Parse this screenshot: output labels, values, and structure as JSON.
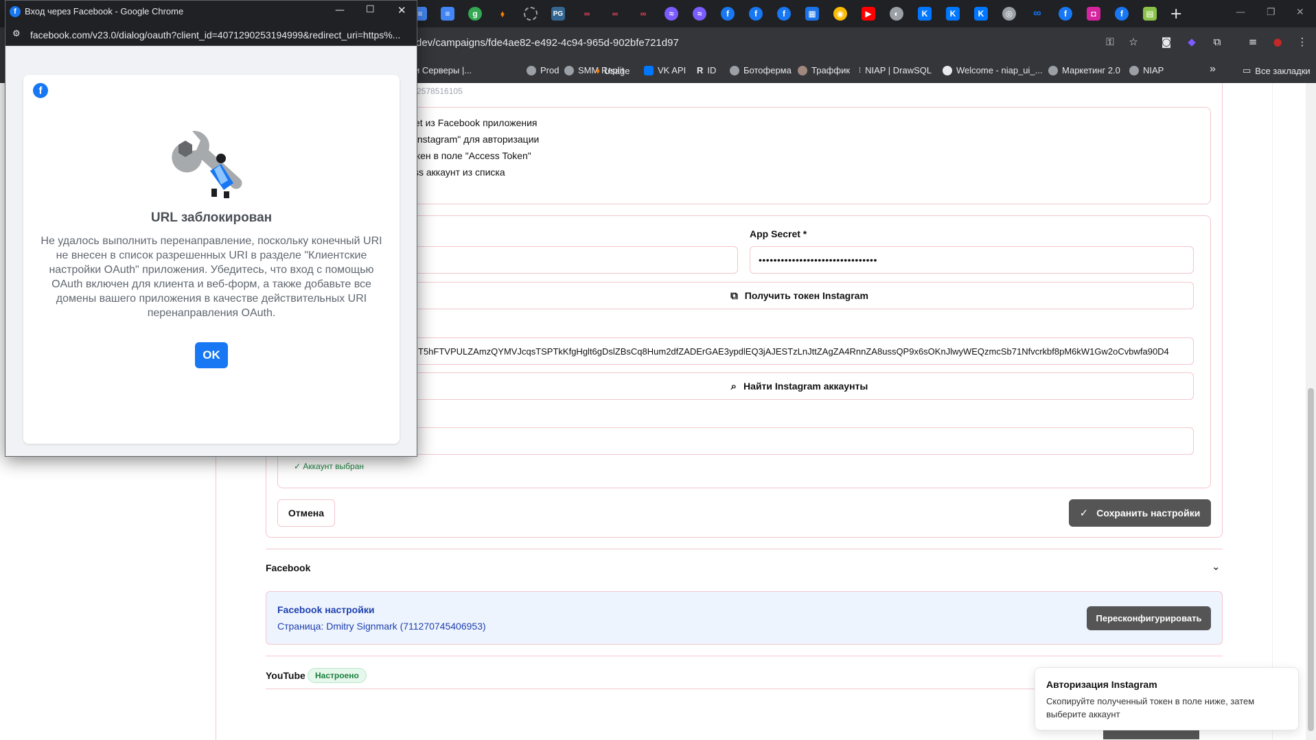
{
  "browser": {
    "url": "dev/campaigns/fde4ae82-e492-4c94-965d-902bfe721d97",
    "bookmarks": [
      "и Серверы |...",
      "Prod",
      "SMM Replit",
      "Usage",
      "VK API",
      "ID",
      "Ботоферма",
      "Траффик",
      "NIAP | DrawSQL",
      "Welcome - niap_ui_...",
      "Маркетинг 2.0",
      "NIAP"
    ],
    "all_bookmarks": "Все закладки",
    "more_glyph": "»"
  },
  "popup": {
    "window_title": "Вход через Facebook - Google Chrome",
    "url": "facebook.com/v23.0/dialog/oauth?client_id=4071290253194999&redirect_uri=https%...",
    "dialog": {
      "title": "URL заблокирован",
      "message": "Не удалось выполнить перенаправление, поскольку конечный URI не внесен в список разрешенных URI в разделе \"Клиентские настройки OAuth\" приложения. Убедитесь, что вход с помощью OAuth включен для клиента и веб-форм, а также добавьте все домены вашего приложения в качестве действительных URI перенаправления OAuth.",
      "ok_label": "OK"
    }
  },
  "instagram": {
    "partial_id": "2578516105",
    "instructions": [
      "et из Facebook приложения",
      "Instagram\" для авторизации",
      "окен в поле \"Access Token\"",
      "ss аккаунт из списка"
    ],
    "app_secret_label": "App Secret *",
    "app_secret_value": "••••••••••••••••••••••••••••••••",
    "get_token_label": "Получить токен Instagram",
    "access_token_value": "T5hFTVPULZAmzQYMVJcqsTSPTkKfgHglt6gDslZBsCq8Hum2dfZADErGAE3ypdlEQ3jAJESTzLnJttZAgZA4RnnZA8ussQP9x6sOKnJlwyWEQzmcSb71Nfvcrkbf8pM6kW1Gw2oCvbwfa90D4",
    "find_accounts_label": "Найти Instagram аккаунты",
    "account_selected": "✓ Аккаунт выбран",
    "cancel_label": "Отмена",
    "save_label": "Сохранить настройки"
  },
  "facebook": {
    "section_title": "Facebook",
    "settings_title": "Facebook настройки",
    "page_line": "Страница: Dmitry Signmark (711270745406953)",
    "reconfigure_label": "Пересконфигурировать"
  },
  "youtube": {
    "section_title": "YouTube",
    "status": "Настроено"
  },
  "toast": {
    "title": "Авторизация Instagram",
    "message": "Скопируйте полученный токен в поле ниже, затем выберите аккаунт"
  },
  "colors": {
    "accent_blue": "#1877f2",
    "border_pink": "#f3c6cc",
    "success_green": "#1a7f3c",
    "dark_button": "#555555"
  }
}
